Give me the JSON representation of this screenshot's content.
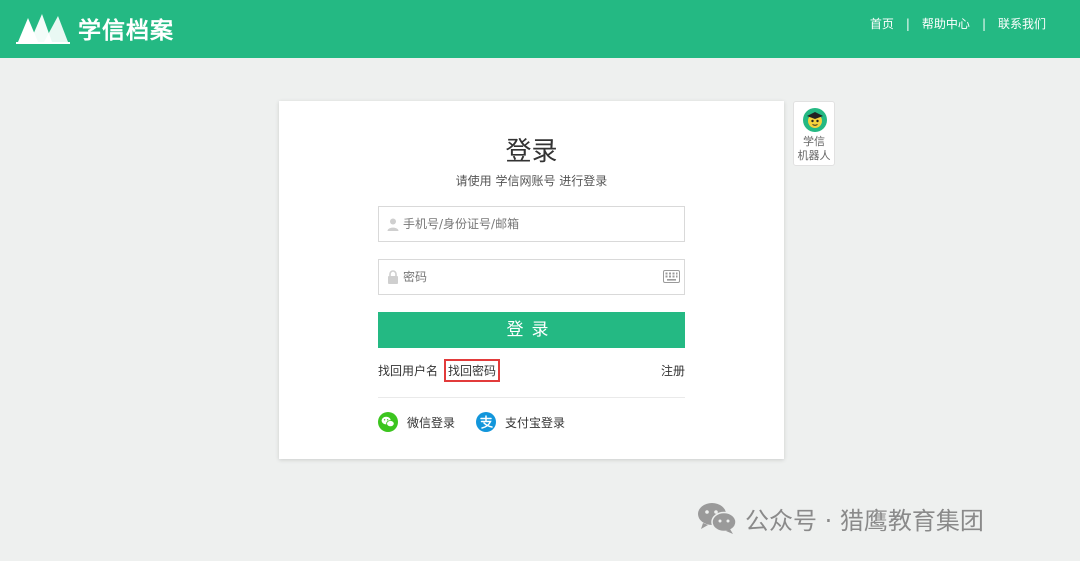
{
  "header": {
    "logo_text": "学信档案",
    "nav": {
      "home": "首页",
      "help": "帮助中心",
      "contact": "联系我们",
      "separator": "|"
    }
  },
  "login": {
    "title": "登录",
    "subtitle": "请使用 学信网账号 进行登录",
    "username_placeholder": "手机号/身份证号/邮箱",
    "password_placeholder": "密码",
    "submit_label": "登录",
    "recover_username": "找回用户名",
    "recover_password": "找回密码",
    "register": "注册",
    "wechat_login": "微信登录",
    "alipay_login": "支付宝登录"
  },
  "robot": {
    "label_line1": "学信",
    "label_line2": "机器人"
  },
  "watermark": {
    "text": "公众号 · 猎鹰教育集团"
  },
  "colors": {
    "brand": "#24b983",
    "highlight": "#e23b3b",
    "wechat": "#3cc51f",
    "alipay": "#1296db"
  },
  "icons": {
    "logo": "book-pages-icon",
    "username": "user-icon",
    "password": "lock-icon",
    "keyboard": "keyboard-icon",
    "wechat": "wechat-icon",
    "alipay": "alipay-icon",
    "robot": "robot-avatar-icon",
    "watermark": "wechat-chat-icon"
  }
}
